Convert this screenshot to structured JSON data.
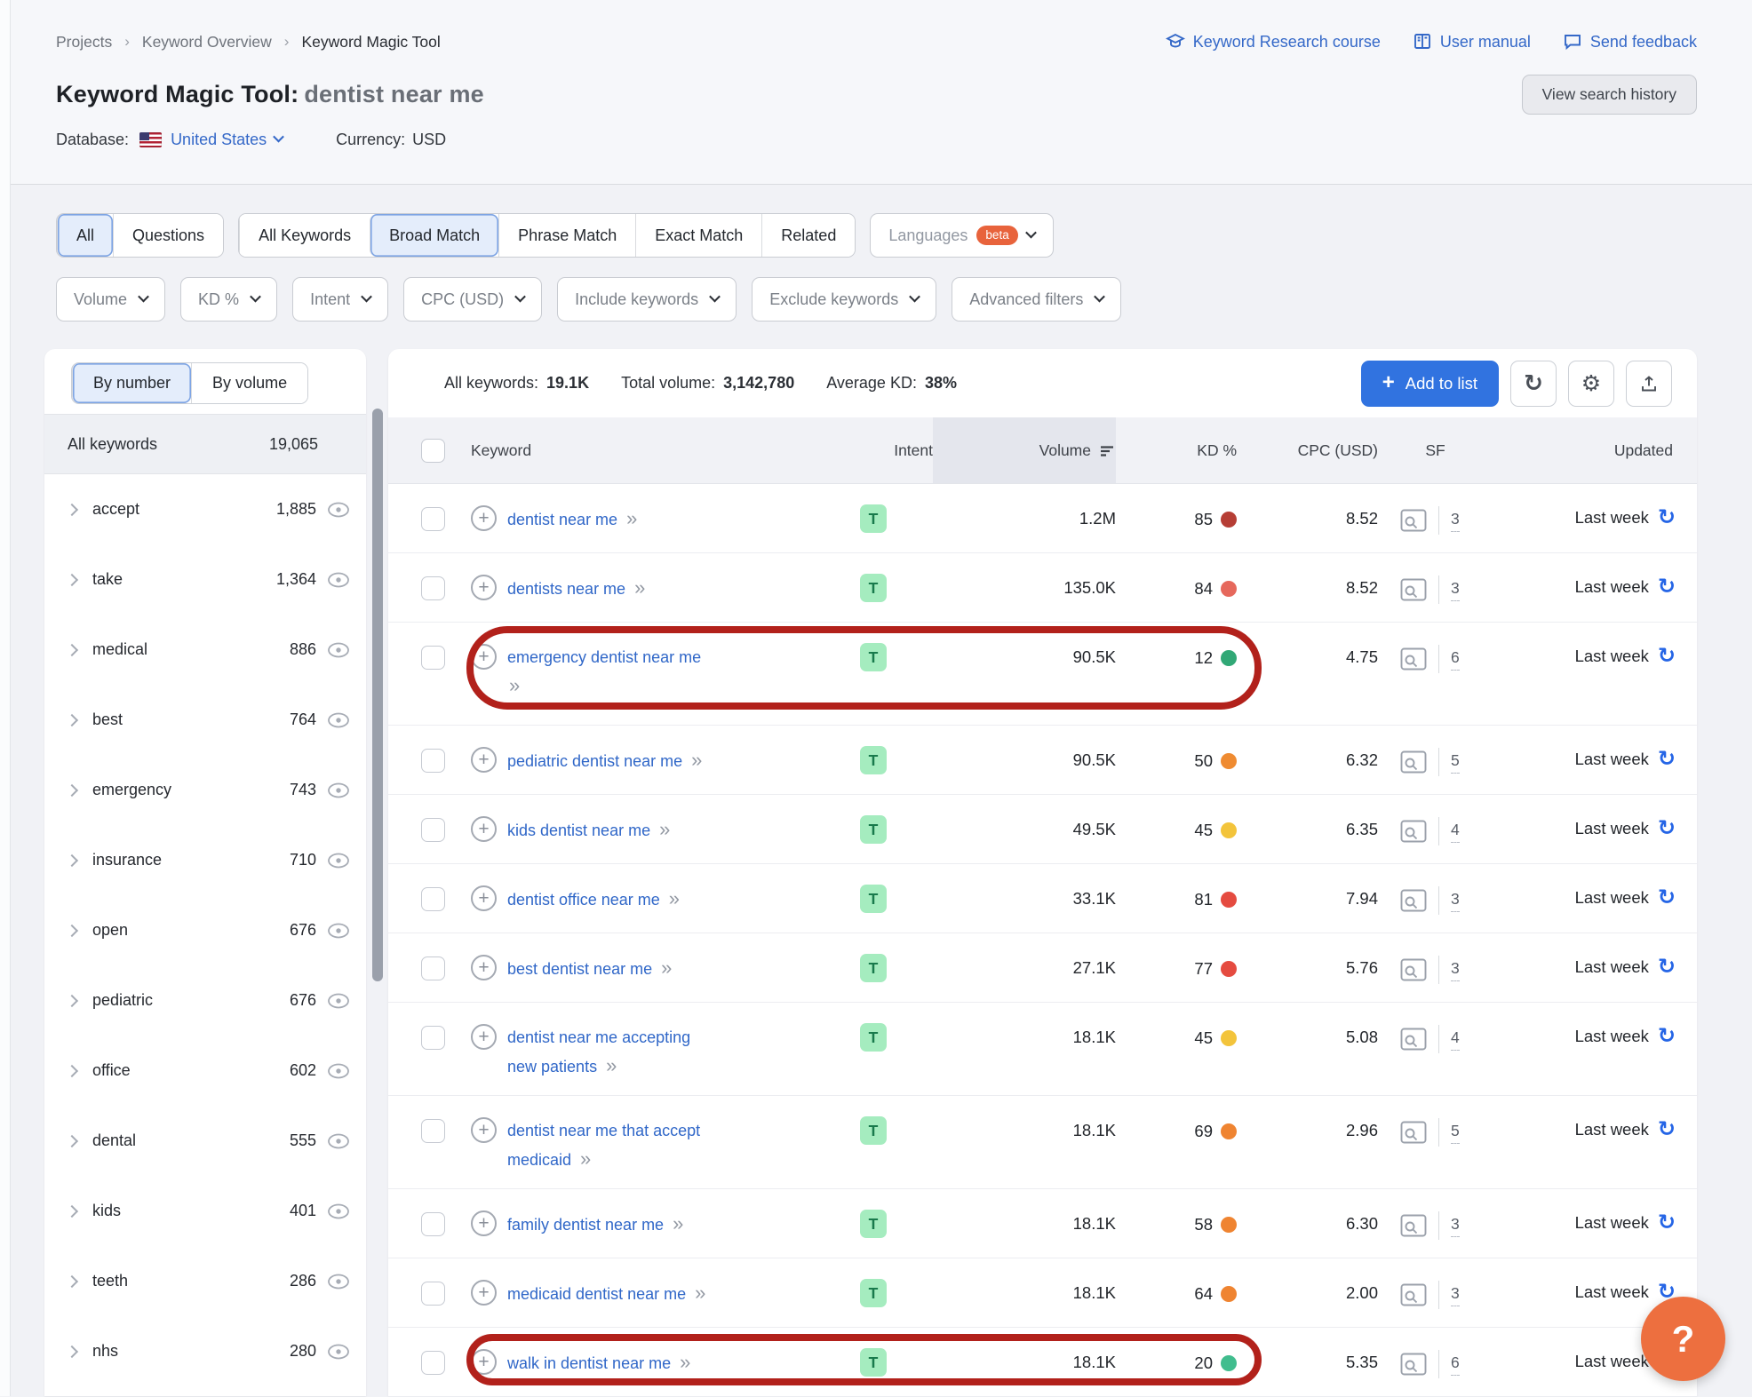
{
  "breadcrumb": [
    "Projects",
    "Keyword Overview",
    "Keyword Magic Tool"
  ],
  "header": {
    "title": "Keyword Magic Tool:",
    "query": "dentist near me",
    "links": {
      "course": "Keyword Research course",
      "manual": "User manual",
      "feedback": "Send feedback"
    },
    "view_history": "View search history",
    "database_label": "Database:",
    "database_value": "United States",
    "currency_label": "Currency:",
    "currency_value": "USD"
  },
  "filters": {
    "tabs1": [
      {
        "label": "All",
        "selected": true
      },
      {
        "label": "Questions",
        "selected": false
      }
    ],
    "tabs2": [
      {
        "label": "All Keywords",
        "selected": false
      },
      {
        "label": "Broad Match",
        "selected": true
      },
      {
        "label": "Phrase Match",
        "selected": false
      },
      {
        "label": "Exact Match",
        "selected": false
      },
      {
        "label": "Related",
        "selected": false
      }
    ],
    "languages_label": "Languages",
    "languages_badge": "beta",
    "dropdowns": [
      {
        "label": "Volume"
      },
      {
        "label": "KD %"
      },
      {
        "label": "Intent"
      },
      {
        "label": "CPC (USD)"
      },
      {
        "label": "Include keywords"
      },
      {
        "label": "Exclude keywords"
      },
      {
        "label": "Advanced filters"
      }
    ]
  },
  "sidebar": {
    "tabs": [
      {
        "label": "By number",
        "selected": true
      },
      {
        "label": "By volume",
        "selected": false
      }
    ],
    "all_label": "All keywords",
    "all_count": "19,065",
    "groups": [
      {
        "label": "accept",
        "count": "1,885"
      },
      {
        "label": "take",
        "count": "1,364"
      },
      {
        "label": "medical",
        "count": "886"
      },
      {
        "label": "best",
        "count": "764"
      },
      {
        "label": "emergency",
        "count": "743"
      },
      {
        "label": "insurance",
        "count": "710"
      },
      {
        "label": "open",
        "count": "676"
      },
      {
        "label": "pediatric",
        "count": "676"
      },
      {
        "label": "office",
        "count": "602"
      },
      {
        "label": "dental",
        "count": "555"
      },
      {
        "label": "kids",
        "count": "401"
      },
      {
        "label": "teeth",
        "count": "286"
      },
      {
        "label": "nhs",
        "count": "280"
      }
    ]
  },
  "stats": {
    "all_keywords_label": "All keywords:",
    "all_keywords": "19.1K",
    "total_volume_label": "Total volume:",
    "total_volume": "3,142,780",
    "avg_kd_label": "Average KD:",
    "avg_kd": "38%",
    "add_to_list": "Add to list"
  },
  "table": {
    "header": {
      "keyword": "Keyword",
      "intent": "Intent",
      "volume": "Volume",
      "kd": "KD %",
      "cpc": "CPC (USD)",
      "sf": "SF",
      "updated": "Updated"
    },
    "rows": [
      {
        "keyword": "dentist near me",
        "intent": "T",
        "volume": "1.2M",
        "kd": "85",
        "kd_color": "#b63e35",
        "cpc": "8.52",
        "sf": "3",
        "updated": "Last week",
        "ring": false,
        "two_line": false,
        "arrow_wrap": false
      },
      {
        "keyword": "dentists near me",
        "intent": "T",
        "volume": "135.0K",
        "kd": "84",
        "kd_color": "#e6685c",
        "cpc": "8.52",
        "sf": "3",
        "updated": "Last week",
        "ring": false,
        "two_line": false,
        "arrow_wrap": false
      },
      {
        "keyword": "emergency dentist near me",
        "intent": "T",
        "volume": "90.5K",
        "kd": "12",
        "kd_color": "#31a876",
        "cpc": "4.75",
        "sf": "6",
        "updated": "Last week",
        "ring": true,
        "two_line": false,
        "arrow_wrap": true
      },
      {
        "keyword": "pediatric dentist near me",
        "intent": "T",
        "volume": "90.5K",
        "kd": "50",
        "kd_color": "#ef8b31",
        "cpc": "6.32",
        "sf": "5",
        "updated": "Last week",
        "ring": false,
        "two_line": false,
        "arrow_wrap": false
      },
      {
        "keyword": "kids dentist near me",
        "intent": "T",
        "volume": "49.5K",
        "kd": "45",
        "kd_color": "#f3c43b",
        "cpc": "6.35",
        "sf": "4",
        "updated": "Last week",
        "ring": false,
        "two_line": false,
        "arrow_wrap": false
      },
      {
        "keyword": "dentist office near me",
        "intent": "T",
        "volume": "33.1K",
        "kd": "81",
        "kd_color": "#e54b40",
        "cpc": "7.94",
        "sf": "3",
        "updated": "Last week",
        "ring": false,
        "two_line": false,
        "arrow_wrap": false
      },
      {
        "keyword": "best dentist near me",
        "intent": "T",
        "volume": "27.1K",
        "kd": "77",
        "kd_color": "#e54b40",
        "cpc": "5.76",
        "sf": "3",
        "updated": "Last week",
        "ring": false,
        "two_line": false,
        "arrow_wrap": false
      },
      {
        "keyword": "dentist near me accepting new patients",
        "intent": "T",
        "volume": "18.1K",
        "kd": "45",
        "kd_color": "#f3c43b",
        "cpc": "5.08",
        "sf": "4",
        "updated": "Last week",
        "ring": false,
        "two_line": true,
        "arrow_wrap": false
      },
      {
        "keyword": "dentist near me that accept medicaid",
        "intent": "T",
        "volume": "18.1K",
        "kd": "69",
        "kd_color": "#ef8431",
        "cpc": "2.96",
        "sf": "5",
        "updated": "Last week",
        "ring": false,
        "two_line": true,
        "arrow_wrap": false
      },
      {
        "keyword": "family dentist near me",
        "intent": "T",
        "volume": "18.1K",
        "kd": "58",
        "kd_color": "#ef8431",
        "cpc": "6.30",
        "sf": "3",
        "updated": "Last week",
        "ring": false,
        "two_line": false,
        "arrow_wrap": false
      },
      {
        "keyword": "medicaid dentist near me",
        "intent": "T",
        "volume": "18.1K",
        "kd": "64",
        "kd_color": "#ef8431",
        "cpc": "2.00",
        "sf": "3",
        "updated": "Last week",
        "ring": false,
        "two_line": false,
        "arrow_wrap": false
      },
      {
        "keyword": "walk in dentist near me",
        "intent": "T",
        "volume": "18.1K",
        "kd": "20",
        "kd_color": "#41bd8e",
        "cpc": "5.35",
        "sf": "6",
        "updated": "Last week",
        "ring": true,
        "two_line": false,
        "arrow_wrap": false
      }
    ]
  },
  "help_button": "?",
  "colors": {
    "accent_blue": "#3173e0",
    "link_blue": "#3067c8",
    "ring_red": "#b2211b",
    "help_orange": "#ed6f3f",
    "intent_badge_bg": "#a5ecbf",
    "intent_badge_text": "#197a4c",
    "beta_badge": "#e8633c"
  }
}
